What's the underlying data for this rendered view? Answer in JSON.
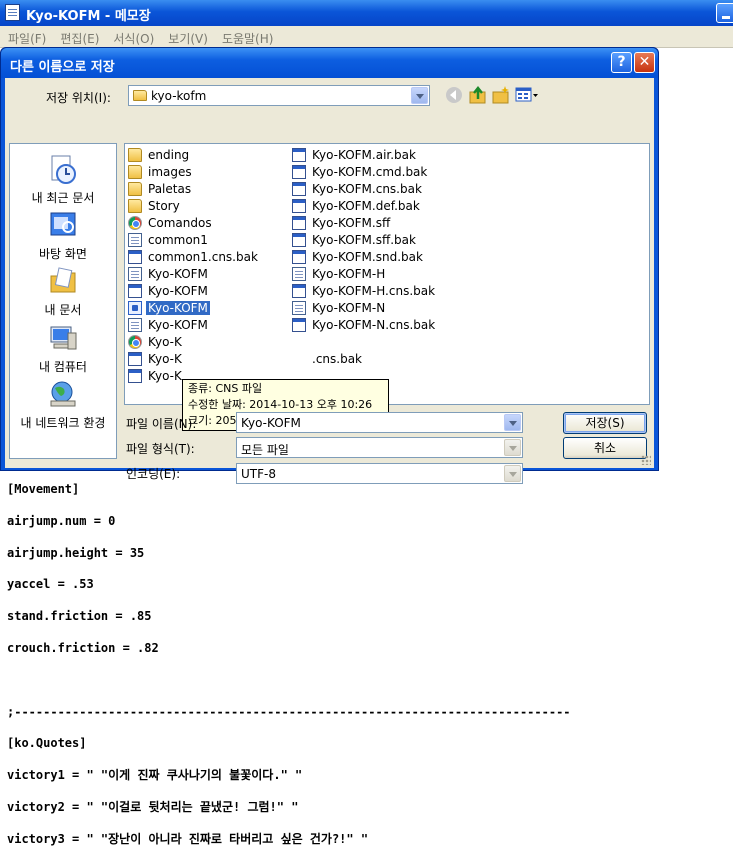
{
  "notepad": {
    "title": "Kyo-KOFM - 메모장",
    "menu": [
      "파일(F)",
      "편집(E)",
      "서식(O)",
      "보기(V)",
      "도움말(H)"
    ],
    "text_lines": [
      "[Movement]",
      "airjump.num = 0",
      "airjump.height = 35",
      "yaccel = .53",
      "stand.friction = .85",
      "crouch.friction = .82",
      "",
      ";-----------------------------------------------------------------------------",
      "[ko.Quotes]",
      "victory1 = \" \"이게 진짜 쿠사나기의 불꽃이다.\" \"",
      "victory2 = \" \"이걸로 뒷처리는 끝냈군! 그럼!\" \"",
      "victory3 = \" \"장난이 아니라 진짜로 타버리고 싶은 건가?!\" \""
    ]
  },
  "dialog": {
    "title": "다른 이름으로 저장",
    "help_button": "?",
    "close_button": "✕",
    "save_in_label": "저장 위치(I):",
    "save_in_value": "kyo-kofm",
    "places": [
      "내 최근 문서",
      "바탕 화면",
      "내 문서",
      "내 컴퓨터",
      "내 네트워크 환경"
    ],
    "files_col1": [
      {
        "name": "ending",
        "icon": "folder"
      },
      {
        "name": "images",
        "icon": "folder"
      },
      {
        "name": "Paletas",
        "icon": "folder"
      },
      {
        "name": "Story",
        "icon": "folder"
      },
      {
        "name": "Comandos",
        "icon": "chrome"
      },
      {
        "name": "common1",
        "icon": "doc"
      },
      {
        "name": "common1.cns.bak",
        "icon": "win"
      },
      {
        "name": "Kyo-KOFM",
        "icon": "doc"
      },
      {
        "name": "Kyo-KOFM",
        "icon": "win"
      },
      {
        "name": "Kyo-KOFM",
        "icon": "blue",
        "selected": true
      },
      {
        "name": "Kyo-KOFM",
        "icon": "doc"
      },
      {
        "name": "Kyo-K",
        "icon": "chrome"
      },
      {
        "name": "Kyo-K",
        "icon": "win"
      },
      {
        "name": "Kyo-K",
        "icon": "win"
      }
    ],
    "files_col2": [
      {
        "name": "Kyo-KOFM.air.bak",
        "icon": "win"
      },
      {
        "name": "Kyo-KOFM.cmd.bak",
        "icon": "win"
      },
      {
        "name": "Kyo-KOFM.cns.bak",
        "icon": "win"
      },
      {
        "name": "Kyo-KOFM.def.bak",
        "icon": "win"
      },
      {
        "name": "Kyo-KOFM.sff",
        "icon": "win"
      },
      {
        "name": "Kyo-KOFM.sff.bak",
        "icon": "win"
      },
      {
        "name": "Kyo-KOFM.snd.bak",
        "icon": "win"
      },
      {
        "name": "Kyo-KOFM-H",
        "icon": "doc"
      },
      {
        "name": "Kyo-KOFM-H.cns.bak",
        "icon": "win"
      },
      {
        "name": "Kyo-KOFM-N",
        "icon": "doc"
      },
      {
        "name": "Kyo-KOFM-N.cns.bak",
        "icon": "win"
      },
      {
        "name": "",
        "icon": "none"
      },
      {
        "name": ".cns.bak",
        "icon": "none"
      }
    ],
    "tooltip": [
      "종류: CNS 파일",
      "수정한 날짜: 2014-10-13 오후 10:26",
      "크기: 205KB"
    ],
    "filename_label": "파일 이름(N):",
    "filename_value": "Kyo-KOFM",
    "filetype_label": "파일 형식(T):",
    "filetype_value": "모든 파일",
    "encoding_label": "인코딩(E):",
    "encoding_value": "UTF-8",
    "save_button": "저장(S)",
    "cancel_button": "취소"
  }
}
